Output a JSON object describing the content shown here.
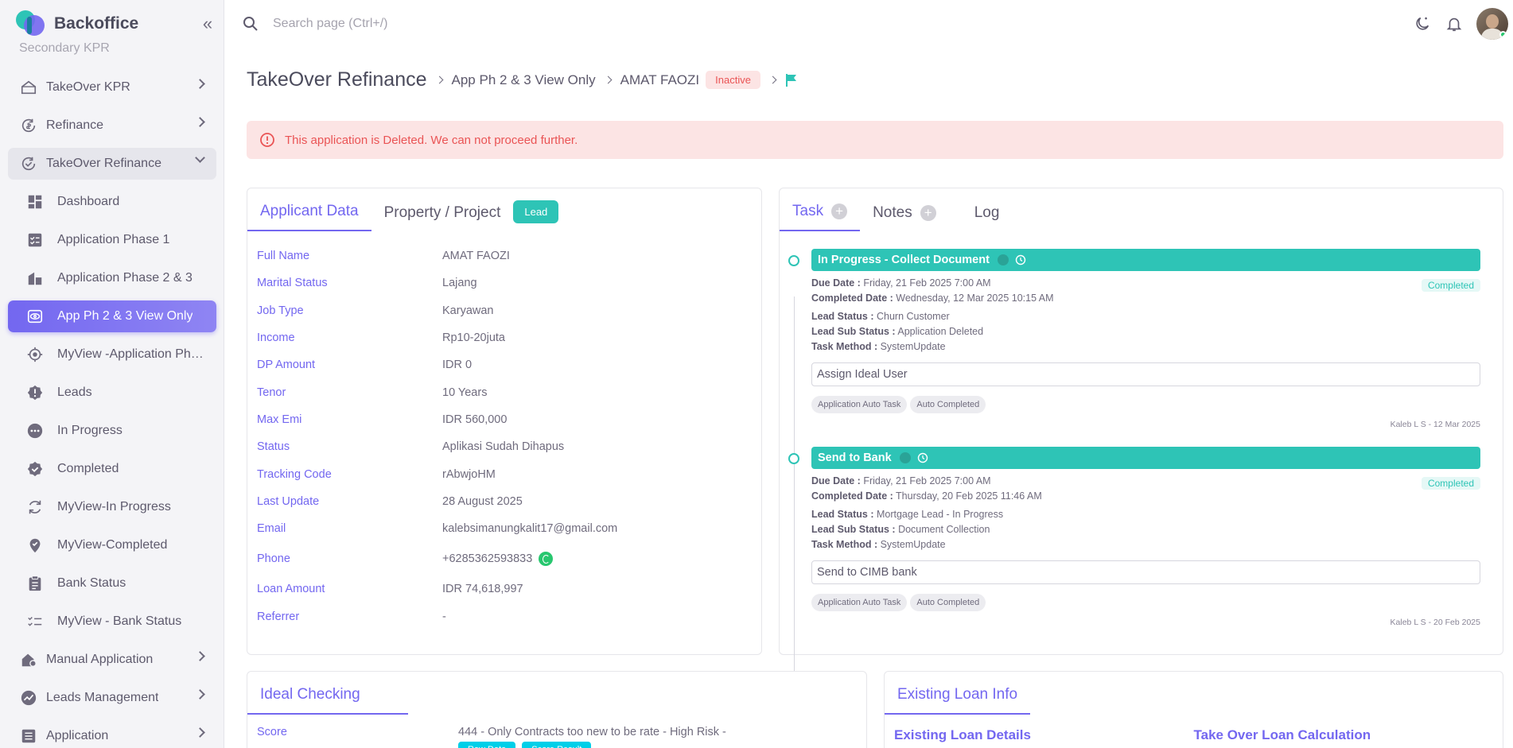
{
  "app": {
    "name": "Backoffice"
  },
  "search": {
    "placeholder": "Search page (Ctrl+/)"
  },
  "sidebar": {
    "partial_item": "Secondary KPR",
    "items": [
      {
        "label": "TakeOver KPR",
        "icon": "home-icon",
        "chevron": true
      },
      {
        "label": "Refinance",
        "icon": "refresh-dollar-icon",
        "chevron": true
      },
      {
        "label": "TakeOver Refinance",
        "icon": "refresh-check-icon",
        "chevron": true,
        "open": true
      },
      {
        "label": "Dashboard",
        "icon": "dashboard-icon",
        "sub": true
      },
      {
        "label": "Application Phase 1",
        "icon": "checklist-icon",
        "sub": true
      },
      {
        "label": "Application Phase 2 & 3",
        "icon": "building-icon",
        "sub": true
      },
      {
        "label": "App Ph 2 & 3 View Only",
        "icon": "eye-icon",
        "sub": true,
        "active": true
      },
      {
        "label": "MyView -Application Phase 1",
        "icon": "target-icon",
        "sub": true
      },
      {
        "label": "Leads",
        "icon": "alert-badge-icon",
        "sub": true
      },
      {
        "label": "In Progress",
        "icon": "dots-circle-icon",
        "sub": true
      },
      {
        "label": "Completed",
        "icon": "check-badge-icon",
        "sub": true
      },
      {
        "label": "MyView-In Progress",
        "icon": "refresh-icon",
        "sub": true
      },
      {
        "label": "MyView-Completed",
        "icon": "location-check-icon",
        "sub": true
      },
      {
        "label": "Bank Status",
        "icon": "clipboard-icon",
        "sub": true
      },
      {
        "label": "MyView - Bank Status",
        "icon": "list-check-icon",
        "sub": true
      },
      {
        "label": "Manual Application",
        "icon": "home-gear-icon",
        "chevron": true
      },
      {
        "label": "Leads Management",
        "icon": "chart-icon",
        "chevron": true
      },
      {
        "label": "Application",
        "icon": "document-icon",
        "chevron": true
      }
    ]
  },
  "breadcrumb": {
    "title": "TakeOver Refinance",
    "item1": "App Ph 2 & 3 View Only",
    "item2": "AMAT FAOZI",
    "badge": "Inactive"
  },
  "alert": {
    "text": "This application is Deleted. We can not proceed further."
  },
  "applicant": {
    "tabs": [
      "Applicant Data",
      "Property / Project"
    ],
    "lead_badge": "Lead",
    "rows": [
      {
        "k": "Full Name",
        "v": "AMAT FAOZI"
      },
      {
        "k": "Marital Status",
        "v": "Lajang"
      },
      {
        "k": "Job Type",
        "v": "Karyawan"
      },
      {
        "k": "Income",
        "v": "Rp10-20juta"
      },
      {
        "k": "DP Amount",
        "v": "IDR 0"
      },
      {
        "k": "Tenor",
        "v": "10 Years"
      },
      {
        "k": "Max Emi",
        "v": "IDR 560,000"
      },
      {
        "k": "Status",
        "v": "Aplikasi Sudah Dihapus"
      },
      {
        "k": "Tracking Code",
        "v": "rAbwjoHM"
      },
      {
        "k": "Last Update",
        "v": "28 August 2025"
      },
      {
        "k": "Email",
        "v": "kalebsimanungkalit17@gmail.com"
      },
      {
        "k": "Phone",
        "v": "+6285362593833"
      },
      {
        "k": "Loan Amount",
        "v": "IDR 74,618,997"
      },
      {
        "k": "Referrer",
        "v": "-"
      }
    ]
  },
  "task_panel": {
    "tabs": [
      "Task",
      "Notes",
      "Log"
    ],
    "entries": [
      {
        "title": "In Progress - Collect Document",
        "status": "Completed",
        "due_label": "Due Date :",
        "due": "Friday, 21 Feb 2025 7:00 AM",
        "completed_label": "Completed Date :",
        "completed": "Wednesday, 12 Mar 2025 10:15 AM",
        "lead_status_label": "Lead Status :",
        "lead_status": "Churn Customer",
        "lead_sub_label": "Lead Sub Status :",
        "lead_sub": "Application Deleted",
        "method_label": "Task Method :",
        "method": "SystemUpdate",
        "box": "Assign Ideal User",
        "chips": [
          "Application Auto Task",
          "Auto Completed"
        ],
        "sign": "Kaleb L S - 12 Mar 2025"
      },
      {
        "title": "Send to Bank",
        "status": "Completed",
        "due_label": "Due Date :",
        "due": "Friday, 21 Feb 2025 7:00 AM",
        "completed_label": "Completed Date :",
        "completed": "Thursday, 20 Feb 2025 11:46 AM",
        "lead_status_label": "Lead Status :",
        "lead_status": "Mortgage Lead - In Progress",
        "lead_sub_label": "Lead Sub Status :",
        "lead_sub": "Document Collection",
        "method_label": "Task Method :",
        "method": "SystemUpdate",
        "box": "Send to CIMB bank",
        "chips": [
          "Application Auto Task",
          "Auto Completed"
        ],
        "sign": "Kaleb L S - 20 Feb 2025"
      }
    ]
  },
  "ideal": {
    "tab": "Ideal Checking",
    "score_label": "Score",
    "score_value": "444 - Only Contracts too new to be rate - High Risk -",
    "btn_raw": "Raw Data",
    "btn_score": "Score Result"
  },
  "loan": {
    "tab": "Existing Loan Info",
    "h1": "Existing Loan Details",
    "h2": "Take Over Loan Calculation"
  },
  "colors": {
    "accent": "#7367f0",
    "teal": "#2ec4b6",
    "danger": "#ea5455"
  }
}
